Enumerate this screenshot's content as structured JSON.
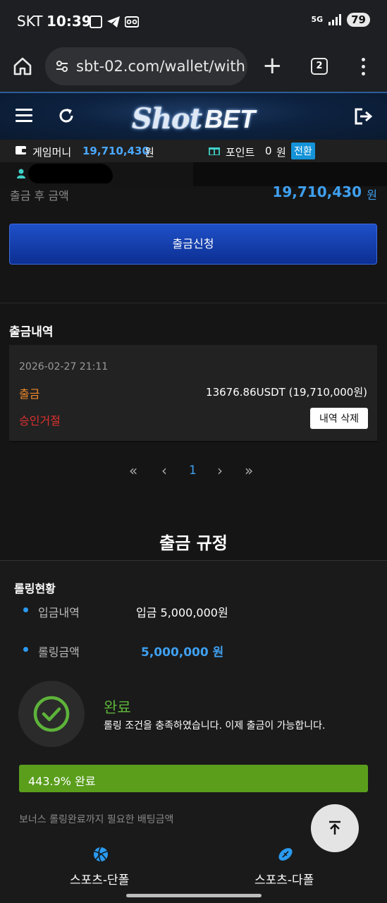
{
  "status_bar": {
    "carrier": "SKT",
    "time": "10:39",
    "network": "5G",
    "battery": "79"
  },
  "browser": {
    "url": "sbt-02.com/wallet/withd",
    "tab_count": "2"
  },
  "site": {
    "logo_shot": "Shot",
    "logo_bet": "BET"
  },
  "wallet": {
    "game_money_label": "게임머니",
    "game_money_value": "19,710,430",
    "won1": "원",
    "point_label": "포인트",
    "point_value": "0",
    "won2": "원",
    "convert_label": "전환"
  },
  "withdraw": {
    "after_label": "출금 후 금액",
    "after_value": "19,710,430",
    "after_unit": "원",
    "apply_button": "출금신청"
  },
  "history": {
    "title": "출금내역",
    "items": [
      {
        "date": "2026-02-27 21:11",
        "type": "출금",
        "amount": "13676.86USDT (19,710,000원)",
        "status": "승인거절",
        "delete_label": "내역 삭제"
      }
    ]
  },
  "pagination": {
    "first": "«",
    "prev": "‹",
    "current": "1",
    "next": "›",
    "last": "»"
  },
  "rules": {
    "title": "출금 규정",
    "rolling_title": "롤링현황",
    "deposit_label": "입금내역",
    "deposit_value": "입금 5,000,000원",
    "rolling_label": "롤링금액",
    "rolling_value": "5,000,000 원",
    "complete_title": "완료",
    "complete_message": "롤링 조건을 충족하였습니다. 이제 출금이 가능합니다.",
    "progress_percent": 100,
    "progress_text": "443.9% 완료",
    "bonus_text": "보너스 롤링완료까지 필요한 배팅금액"
  },
  "bottom_nav": {
    "sports_single": "스포츠-단폴",
    "sports_multi": "스포츠-다폴"
  },
  "colors": {
    "accent_blue": "#3fa0f0",
    "success_green": "#5a9e1c",
    "withdraw_orange": "#f08a2a",
    "reject_red": "#e03030"
  }
}
